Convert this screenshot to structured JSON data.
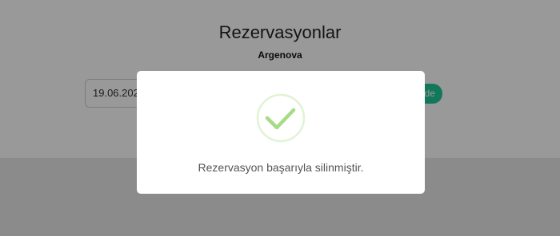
{
  "page": {
    "title": "Rezervasyonlar",
    "subtitle": "Argenova",
    "date_value": "19.06.202",
    "list_button_label": "de"
  },
  "modal": {
    "icon": "success-check-icon",
    "message": "Rezervasyon başarıyla silinmiştir."
  },
  "colors": {
    "accent": "#20c997",
    "check": "#a5dc86",
    "overlay": "rgba(0,0,0,0.4)"
  }
}
